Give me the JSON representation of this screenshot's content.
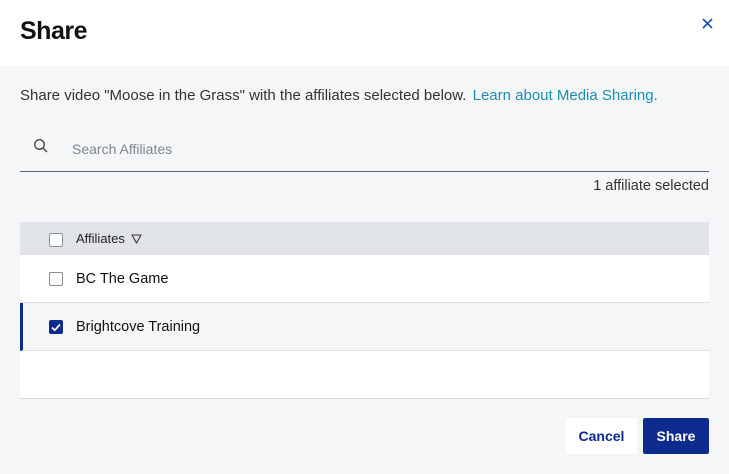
{
  "dialog": {
    "title": "Share",
    "close_icon": "close-icon"
  },
  "intro": {
    "text": "Share video \"Moose in the Grass\" with the affiliates selected below.",
    "link": "Learn about Media Sharing."
  },
  "search": {
    "placeholder": "Search Affiliates",
    "value": "",
    "icon": "search-icon"
  },
  "selection": {
    "count_text": "1 affiliate selected"
  },
  "table": {
    "header": {
      "label": "Affiliates",
      "checked": false,
      "sort_icon": "triangle-down-icon"
    },
    "rows": [
      {
        "label": "BC The Game",
        "checked": false
      },
      {
        "label": "Brightcove Training",
        "checked": true
      }
    ]
  },
  "footer": {
    "cancel_label": "Cancel",
    "share_label": "Share"
  },
  "colors": {
    "primary": "#0d2b8f",
    "link": "#1a8fb5",
    "background": "#f5f6f7"
  }
}
